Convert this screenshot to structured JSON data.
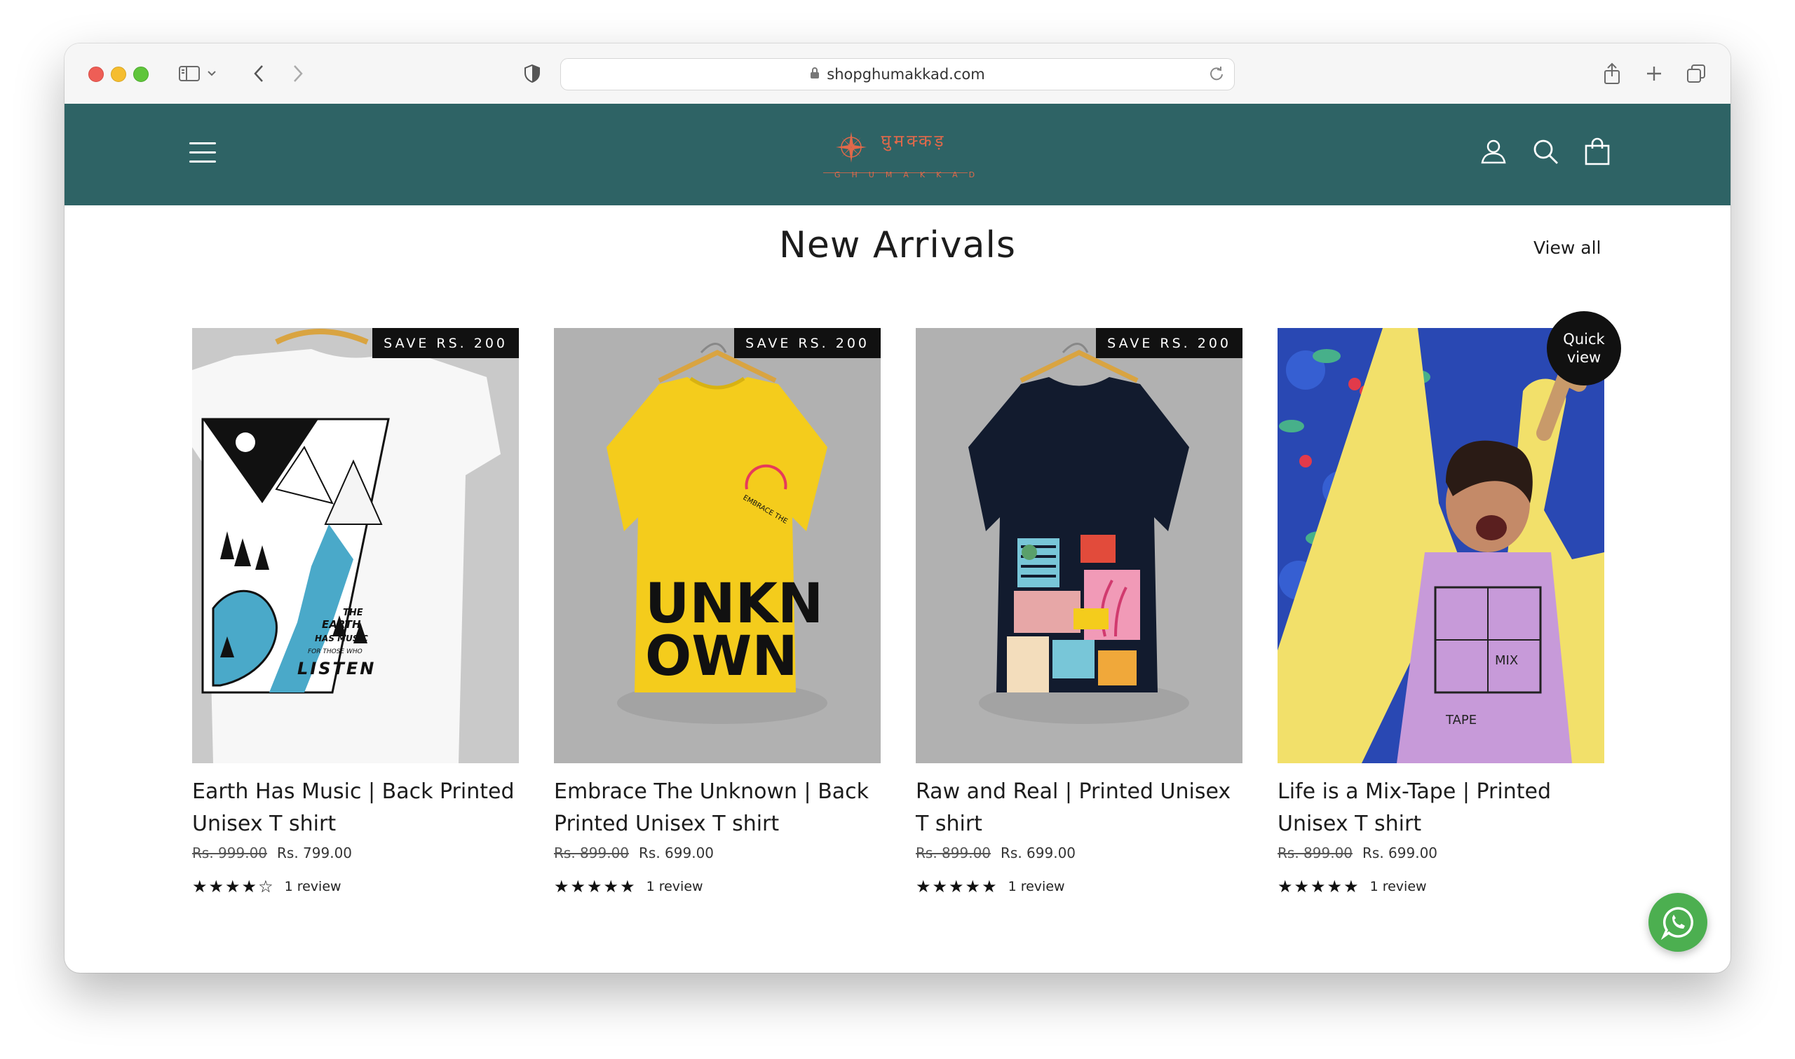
{
  "browser": {
    "url": "shopghumakkad.com",
    "icons": [
      "sidebar-icon",
      "chevron-down-icon",
      "back-arrow-icon",
      "forward-arrow-icon",
      "shield-icon",
      "lock-icon",
      "reload-icon",
      "share-icon",
      "plus-icon",
      "tabs-icon"
    ]
  },
  "header": {
    "logo_script": "घुमक्कड़",
    "logo_word": "GHUMAKKAD",
    "bg_color": "#2e6365",
    "accent_color": "#e1694a"
  },
  "section": {
    "title": "New Arrivals",
    "view_all": "View all"
  },
  "products": [
    {
      "title": "Earth Has Music | Back Printed Unisex T shirt",
      "badge": "SAVE RS. 200",
      "old_price": "Rs. 999.00",
      "price": "Rs. 799.00",
      "rating": 4,
      "stars": "★★★★☆",
      "reviews": "1 review",
      "art_text": [
        "THE",
        "EARTH",
        "HAS MUSIC",
        "FOR THOSE WHO",
        "LISTEN"
      ]
    },
    {
      "title": "Embrace The Unknown | Back Printed Unisex T shirt",
      "badge": "SAVE RS. 200",
      "old_price": "Rs. 899.00",
      "price": "Rs. 699.00",
      "rating": 5,
      "stars": "★★★★★",
      "reviews": "1 review",
      "art_text": [
        "UNKN",
        "OWN",
        "EMBRACE THE"
      ]
    },
    {
      "title": "Raw and Real | Printed Unisex T shirt",
      "badge": "SAVE RS. 200",
      "old_price": "Rs. 899.00",
      "price": "Rs. 699.00",
      "rating": 5,
      "stars": "★★★★★",
      "reviews": "1 review"
    },
    {
      "title": "Life is a Mix-Tape | Printed Unisex T shirt",
      "quick_view": "Quick view",
      "old_price": "Rs. 899.00",
      "price": "Rs. 699.00",
      "rating": 5,
      "stars": "★★★★★",
      "reviews": "1 review",
      "art_text": [
        "MIX",
        "TAPE"
      ]
    }
  ],
  "whatsapp_color": "#4caf50"
}
